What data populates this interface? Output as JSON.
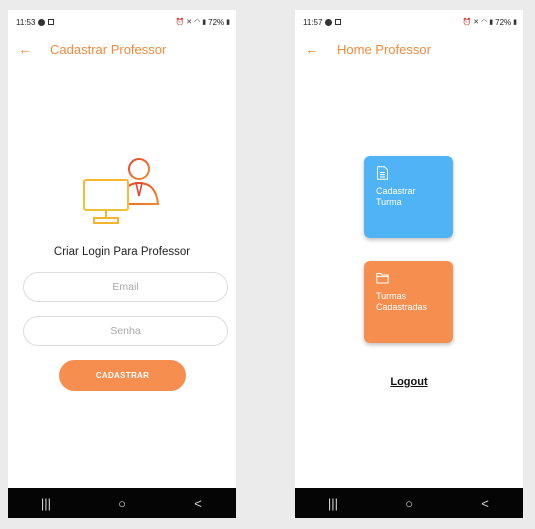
{
  "screens": {
    "left": {
      "status_time": "11:53",
      "battery": "72%",
      "title": "Cadastrar Professor",
      "heading": "Criar Login Para Professor",
      "email_placeholder": "Email",
      "password_placeholder": "Senha",
      "submit_label": "CADASTRAR",
      "illustration": "teacher-computer-icon"
    },
    "right": {
      "status_time": "11:57",
      "battery": "72%",
      "title": "Home Professor",
      "tiles": [
        {
          "label_line1": "Cadastrar",
          "label_line2": "Turma",
          "icon": "document-icon",
          "color": "#4fb3f6"
        },
        {
          "label_line1": "Turmas",
          "label_line2": "Cadastradas",
          "icon": "folder-icon",
          "color": "#f58e4f"
        }
      ],
      "logout_label": "Logout"
    }
  },
  "navbar": {
    "recents_icon": "|||",
    "home_icon": "○",
    "back_icon": "<"
  },
  "colors": {
    "accent": "#f08a3e",
    "button": "#f58e4f",
    "tile_blue": "#4fb3f6"
  }
}
